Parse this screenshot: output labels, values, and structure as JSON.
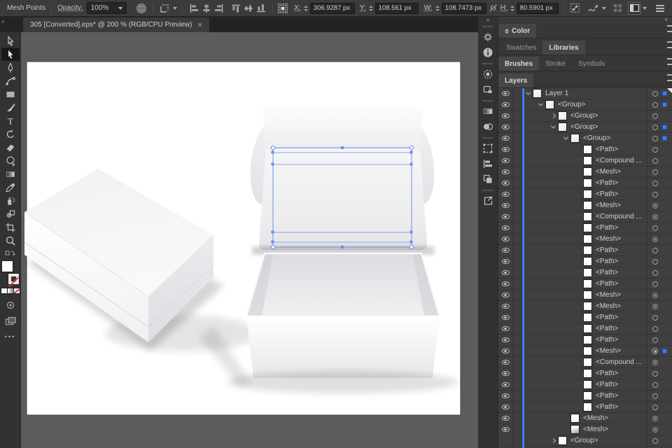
{
  "colors": {
    "accent": "#3E7EF0",
    "mesh_line": "#6A8FE8",
    "pasteboard": "#5C5C5C",
    "artboard": "#FFFFFF"
  },
  "toolbar": {
    "context_label": "Mesh Points",
    "opacity": {
      "label": "Opacity:",
      "value": "100%"
    },
    "fields": [
      {
        "label": "X:",
        "value": "306.9287 px"
      },
      {
        "label": "Y:",
        "value": "108.561 px"
      },
      {
        "label": "W:",
        "value": "108.7473 px"
      },
      {
        "label": "H:",
        "value": "80.5901 px"
      }
    ]
  },
  "tab": {
    "title": "305 [Converted].eps* @ 200 % (RGB/CPU Preview)",
    "close": "×"
  },
  "dock": {
    "collapse_left": "«",
    "collapse_right": "»"
  },
  "panels": {
    "color": "Color",
    "swatches": "Swatches",
    "libraries": "Libraries",
    "brushes": "Brushes",
    "stroke": "Stroke",
    "symbols": "Symbols",
    "layers": "Layers"
  },
  "layers": {
    "rows": [
      {
        "name": "Layer 1",
        "indent": 0,
        "exp": "open",
        "eye": 1,
        "tgt": "ring",
        "chip": 1,
        "thumb": "tex"
      },
      {
        "name": "<Group>",
        "indent": 1,
        "exp": "open",
        "eye": 1,
        "tgt": "ring",
        "chip": 1,
        "thumb": "tex"
      },
      {
        "name": "<Group>",
        "indent": 2,
        "exp": "closed",
        "eye": 1,
        "tgt": "ring",
        "chip": 0,
        "thumb": "tex"
      },
      {
        "name": "<Group>",
        "indent": 2,
        "exp": "open",
        "eye": 1,
        "tgt": "ring",
        "chip": 1,
        "thumb": "tex"
      },
      {
        "name": "<Group>",
        "indent": 3,
        "exp": "open",
        "eye": 1,
        "tgt": "ring",
        "chip": 1,
        "thumb": "tex"
      },
      {
        "name": "<Path>",
        "indent": 4,
        "eye": 1,
        "tgt": "ring"
      },
      {
        "name": "<Compound ...",
        "indent": 4,
        "eye": 1,
        "tgt": "ring"
      },
      {
        "name": "<Mesh>",
        "indent": 4,
        "eye": 1,
        "tgt": "ring"
      },
      {
        "name": "<Path>",
        "indent": 4,
        "eye": 1,
        "tgt": "ring"
      },
      {
        "name": "<Path>",
        "indent": 4,
        "eye": 1,
        "tgt": "ring"
      },
      {
        "name": "<Mesh>",
        "indent": 4,
        "eye": 1,
        "tgt": "dot"
      },
      {
        "name": "<Compound ...",
        "indent": 4,
        "eye": 1,
        "tgt": "dot"
      },
      {
        "name": "<Path>",
        "indent": 4,
        "eye": 1,
        "tgt": "ring"
      },
      {
        "name": "<Mesh>",
        "indent": 4,
        "eye": 1,
        "tgt": "dot"
      },
      {
        "name": "<Path>",
        "indent": 4,
        "eye": 1,
        "tgt": "ring"
      },
      {
        "name": "<Path>",
        "indent": 4,
        "eye": 1,
        "tgt": "ring"
      },
      {
        "name": "<Path>",
        "indent": 4,
        "eye": 1,
        "tgt": "ring"
      },
      {
        "name": "<Path>",
        "indent": 4,
        "eye": 1,
        "tgt": "ring"
      },
      {
        "name": "<Mesh>",
        "indent": 4,
        "eye": 1,
        "tgt": "dot"
      },
      {
        "name": "<Mesh>",
        "indent": 4,
        "eye": 1,
        "tgt": "dot"
      },
      {
        "name": "<Path>",
        "indent": 4,
        "eye": 1,
        "tgt": "ring"
      },
      {
        "name": "<Path>",
        "indent": 4,
        "eye": 1,
        "tgt": "ring"
      },
      {
        "name": "<Path>",
        "indent": 4,
        "eye": 1,
        "tgt": "ring"
      },
      {
        "name": "<Mesh>",
        "indent": 4,
        "eye": 1,
        "tgt": "dot-sel",
        "chip": 1
      },
      {
        "name": "<Compound ...",
        "indent": 4,
        "eye": 1,
        "tgt": "dot"
      },
      {
        "name": "<Path>",
        "indent": 4,
        "eye": 1,
        "tgt": "ring"
      },
      {
        "name": "<Path>",
        "indent": 4,
        "eye": 1,
        "tgt": "ring"
      },
      {
        "name": "<Path>",
        "indent": 4,
        "eye": 1,
        "tgt": "ring"
      },
      {
        "name": "<Path>",
        "indent": 4,
        "eye": 1,
        "tgt": "ring"
      },
      {
        "name": "<Mesh>",
        "indent": 3,
        "eye": 1,
        "tgt": "dot"
      },
      {
        "name": "<Mesh>",
        "indent": 3,
        "eye": 1,
        "tgt": "dot",
        "thumb": "dark"
      },
      {
        "name": "<Group>",
        "indent": 2,
        "exp": "closed",
        "eye": 0,
        "tgt": "ring"
      }
    ]
  }
}
